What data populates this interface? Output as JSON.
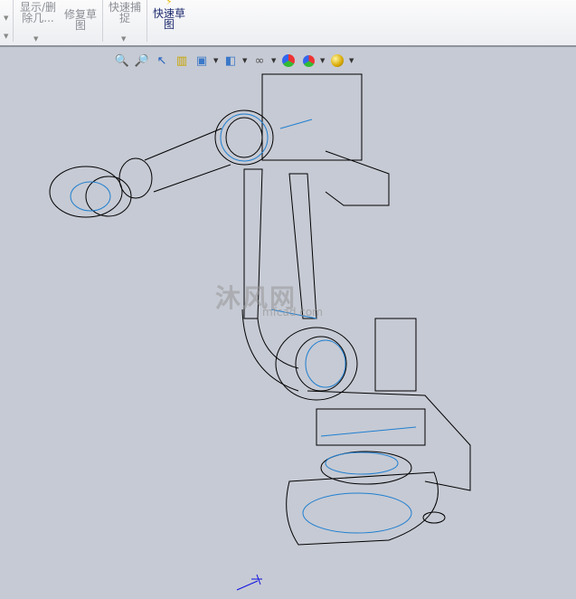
{
  "ribbon": {
    "buttons": [
      {
        "label": "显示/删除几...",
        "enabled": false
      },
      {
        "label": "修复草图",
        "enabled": false
      },
      {
        "label": "快速捕捉",
        "enabled": false
      },
      {
        "label": "快速草图",
        "enabled": true
      }
    ]
  },
  "headsup_toolbar": {
    "icons": [
      "zoom-to-fit-icon",
      "zoom-to-area-icon",
      "previous-view-icon",
      "section-view-icon",
      "view-orientation-icon",
      "display-style-icon",
      "hide-show-items-icon",
      "edit-appearance-icon",
      "apply-scene-icon",
      "view-settings-icon"
    ]
  },
  "watermark": {
    "text": "沐风网",
    "url_text": "mfcad.com"
  },
  "colors": {
    "viewport": "#c6cad4",
    "edge_black": "#000000",
    "edge_blue": "#1f7fd0",
    "triad": "#1010e0"
  }
}
